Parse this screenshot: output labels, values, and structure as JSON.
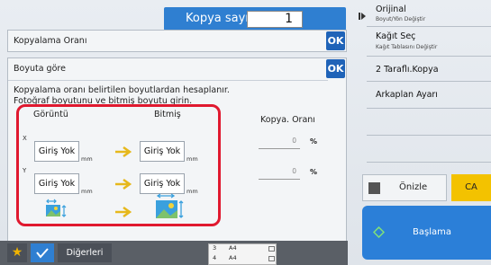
{
  "copy_bar": {
    "label": "Kopya sayısı",
    "value": "1"
  },
  "side_menu": {
    "items": [
      {
        "title": "Orijinal",
        "sub": "Boyut/Yön Değiştir"
      },
      {
        "title": "Kağıt Seç",
        "sub": "Kağıt Tablasını Değiştir"
      },
      {
        "title": "2 Taraflı.Kopya",
        "sub": ""
      },
      {
        "title": "Arkaplan Ayarı",
        "sub": ""
      }
    ]
  },
  "ratio_panel": {
    "title": "Kopyalama Oranı",
    "ok": "OK"
  },
  "main_panel": {
    "title": "Boyuta göre",
    "ok": "OK",
    "desc_line1": "Kopyalama oranı belirtilen boyutlardan hesaplanır.",
    "desc_line2": "Fotoğraf boyutunu ve bitmiş boyutu girin."
  },
  "size_group": {
    "col_original": "Görüntü",
    "col_finished": "Bitmiş",
    "rows": [
      {
        "axis": "X",
        "original": "Giriş Yok",
        "finished": "Giriş Yok",
        "unit": "mm"
      },
      {
        "axis": "Y",
        "original": "Giriş Yok",
        "finished": "Giriş Yok",
        "unit": "mm"
      }
    ]
  },
  "ratio": {
    "heading": "Kopya. Oranı",
    "x_value": "0",
    "y_value": "0",
    "unit": "%"
  },
  "buttons": {
    "preview": "Önizle",
    "ca": "CA",
    "start": "Başlama",
    "others": "Diğerleri"
  },
  "tray": [
    {
      "num": "3",
      "size": "A4"
    },
    {
      "num": "4",
      "size": "A4"
    }
  ],
  "colors": {
    "accent": "#2f7fd1",
    "ok": "#1f63b8",
    "highlight": "#e0192f",
    "ca": "#f3c200"
  }
}
